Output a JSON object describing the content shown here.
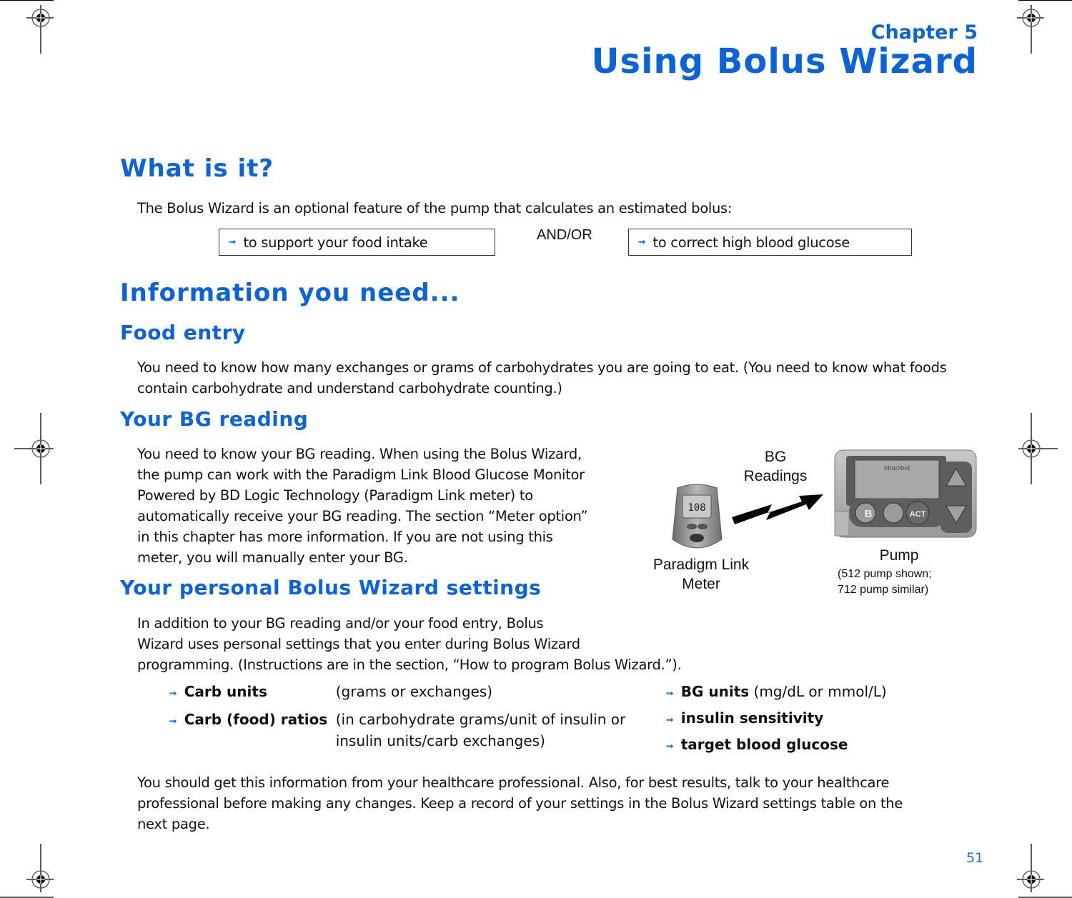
{
  "header": {
    "chapter_label": "Chapter 5",
    "chapter_title": "Using Bolus Wizard"
  },
  "what_is_it": {
    "heading": "What is it?",
    "intro": "The Bolus Wizard is an optional feature of the pump that calculates an estimated bolus:",
    "options": [
      {
        "label": "to support your food intake",
        "icon": "arrow-bullet-icon"
      },
      {
        "label": "to correct high blood glucose",
        "icon": "arrow-bullet-icon"
      }
    ],
    "connector": "AND/OR"
  },
  "info_needed": {
    "heading": "Information you need...",
    "food_entry": {
      "heading": "Food entry",
      "text": "You need to know how many exchanges or grams of carbohydrates you are going to eat. (You need to know what foods contain carbohydrate and understand carbohydrate counting.)"
    },
    "bg_reading": {
      "heading": "Your BG reading",
      "lines": [
        "You need to know your BG reading. When using the Bolus Wizard,",
        "the pump can work with the Paradigm Link Blood Glucose Monitor",
        "Powered by BD Logic Technology (Paradigm Link meter) to",
        "automatically receive your BG reading. The section “Meter option”",
        "in this chapter has more information. If you are not using this",
        "meter, you will manually enter your BG."
      ]
    },
    "figure": {
      "transfer_label_line1": "BG",
      "transfer_label_line2": "Readings",
      "meter_label_line1": "Paradigm Link",
      "meter_label_line2": "Meter",
      "meter_display": "108",
      "pump_label": "Pump",
      "pump_note_line1": "(512 pump shown;",
      "pump_note_line2": "712 pump similar)",
      "pump_brand": "MiniMed",
      "pump_buttons": [
        "B",
        "ACT"
      ]
    },
    "personal_settings": {
      "heading": "Your personal Bolus Wizard settings",
      "lines": [
        "In addition to your BG reading and/or your food entry, Bolus",
        "Wizard uses personal settings that you enter during Bolus Wizard",
        "programming. (Instructions are in the section, “How to program Bolus Wizard.”)."
      ],
      "left_items": [
        {
          "term": "Carb units",
          "desc": "(grams or exchanges)"
        },
        {
          "term": "Carb (food) ratios",
          "desc_line1": "(in carbohydrate grams/unit of insulin or",
          "desc_line2": "insulin units/carb exchanges)"
        }
      ],
      "right_items": [
        {
          "term": "BG units",
          "desc": "(mg/dL or mmol/L)"
        },
        {
          "term": "insulin sensitivity",
          "desc": ""
        },
        {
          "term": "target blood glucose",
          "desc": ""
        }
      ],
      "closing_lines": [
        "You should get this information from your healthcare professional. Also, for best results, talk to your healthcare",
        "professional before making any changes. Keep a record of your settings in the Bolus Wizard settings table on the",
        "next page."
      ]
    }
  },
  "footer": {
    "page_number": "51"
  },
  "icons": {
    "bullet": "➟"
  }
}
